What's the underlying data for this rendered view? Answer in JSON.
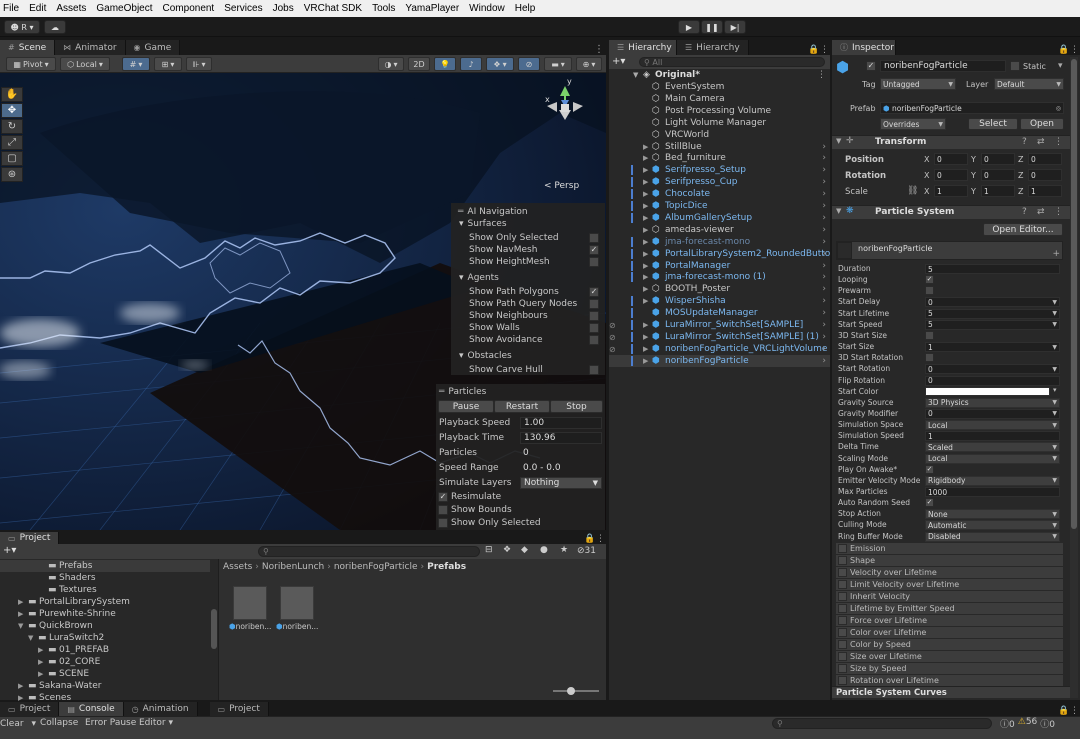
{
  "menubar": [
    "File",
    "Edit",
    "Assets",
    "GameObject",
    "Component",
    "Services",
    "Jobs",
    "VRChat SDK",
    "Tools",
    "YamaPlayer",
    "Window",
    "Help"
  ],
  "toolbar": {
    "account_label": "R"
  },
  "scene": {
    "tabs": [
      "Scene",
      "Animator",
      "Game"
    ],
    "pivot": "Pivot",
    "local": "Local",
    "mode_2d": "2D",
    "persp": "Persp",
    "ai_nav": {
      "title": "AI Navigation",
      "surfaces": "Surfaces",
      "surf_items": [
        {
          "label": "Show Only Selected",
          "checked": false
        },
        {
          "label": "Show NavMesh",
          "checked": true
        },
        {
          "label": "Show HeightMesh",
          "checked": false
        }
      ],
      "agents": "Agents",
      "agent_items": [
        {
          "label": "Show Path Polygons",
          "checked": true
        },
        {
          "label": "Show Path Query Nodes",
          "checked": false
        },
        {
          "label": "Show Neighbours",
          "checked": false
        },
        {
          "label": "Show Walls",
          "checked": false
        },
        {
          "label": "Show Avoidance",
          "checked": false
        }
      ],
      "obstacles": "Obstacles",
      "obstacle_items": [
        {
          "label": "Show Carve Hull",
          "checked": false
        }
      ]
    },
    "particles": {
      "title": "Particles",
      "pause": "Pause",
      "restart": "Restart",
      "stop": "Stop",
      "rows": [
        {
          "label": "Playback Speed",
          "value": "1.00"
        },
        {
          "label": "Playback Time",
          "value": "130.96"
        },
        {
          "label": "Particles",
          "value": "0"
        },
        {
          "label": "Speed Range",
          "value": "0.0 - 0.0"
        },
        {
          "label": "Simulate Layers",
          "value": "Nothing"
        }
      ],
      "checks": [
        {
          "label": "Resimulate",
          "checked": true
        },
        {
          "label": "Show Bounds",
          "checked": false
        },
        {
          "label": "Show Only Selected",
          "checked": false
        }
      ]
    }
  },
  "hierarchy": {
    "tabs": [
      "Hierarchy",
      "Hierarchy"
    ],
    "search_placeholder": "All",
    "root": "Original*",
    "items": [
      {
        "name": "EventSystem",
        "type": "go",
        "arrow": false
      },
      {
        "name": "Main Camera",
        "type": "go",
        "arrow": false
      },
      {
        "name": "Post Processing Volume",
        "type": "go",
        "arrow": false
      },
      {
        "name": "Light Volume Manager",
        "type": "go",
        "arrow": false
      },
      {
        "name": "VRCWorld",
        "type": "go",
        "arrow": false
      },
      {
        "name": "StillBlue",
        "type": "go",
        "arrow": true
      },
      {
        "name": "Bed_furniture",
        "type": "go",
        "arrow": true
      },
      {
        "name": "Serifpresso_Setup",
        "type": "prefab",
        "arrow": true
      },
      {
        "name": "Serifpresso_Cup",
        "type": "prefab",
        "arrow": true
      },
      {
        "name": "Chocolate",
        "type": "prefab",
        "arrow": true
      },
      {
        "name": "TopicDice",
        "type": "prefab",
        "arrow": true
      },
      {
        "name": "AlbumGallerySetup",
        "type": "prefab",
        "arrow": true
      },
      {
        "name": "amedas-viewer",
        "type": "go",
        "arrow": true
      },
      {
        "name": "jma-forecast-mono",
        "type": "dis",
        "arrow": true
      },
      {
        "name": "PortalLibrarySystem2_RoundedButto",
        "type": "prefab",
        "arrow": true
      },
      {
        "name": "PortalManager",
        "type": "prefab",
        "arrow": true
      },
      {
        "name": "jma-forecast-mono (1)",
        "type": "prefab",
        "arrow": true
      },
      {
        "name": "BOOTH_Poster",
        "type": "go",
        "arrow": true
      },
      {
        "name": "WisperShisha",
        "type": "prefab",
        "arrow": true
      },
      {
        "name": "MOSUpdateManager",
        "type": "prefab",
        "arrow": false
      },
      {
        "name": "LuraMirror_SwitchSet[SAMPLE]",
        "type": "prefab",
        "arrow": true
      },
      {
        "name": "LuraMirror_SwitchSet[SAMPLE] (1)",
        "type": "prefab",
        "arrow": true
      },
      {
        "name": "noribenFogParticle_VRCLightVolume",
        "type": "prefab",
        "arrow": true
      },
      {
        "name": "noribenFogParticle",
        "type": "prefab",
        "arrow": true,
        "selected": true
      }
    ]
  },
  "inspector": {
    "tab": "Inspector",
    "object_name": "noribenFogParticle",
    "static_label": "Static",
    "tag_label": "Tag",
    "tag_value": "Untagged",
    "layer_label": "Layer",
    "layer_value": "Default",
    "prefab_label": "Prefab",
    "prefab_value": "noribenFogParticle",
    "overrides": "Overrides",
    "select": "Select",
    "open": "Open",
    "transform": {
      "title": "Transform",
      "rows": [
        {
          "label": "Position",
          "x": "0",
          "y": "0",
          "z": "0"
        },
        {
          "label": "Rotation",
          "x": "0",
          "y": "0",
          "z": "0"
        },
        {
          "label": "Scale",
          "x": "1",
          "y": "1",
          "z": "1"
        }
      ]
    },
    "particle_system": {
      "title": "Particle System",
      "open_editor": "Open Editor...",
      "header": "noribenFogParticle",
      "props": [
        {
          "label": "Duration",
          "value": "5",
          "kind": "field"
        },
        {
          "label": "Looping",
          "value": "✓",
          "kind": "check"
        },
        {
          "label": "Prewarm",
          "value": "",
          "kind": "check"
        },
        {
          "label": "Start Delay",
          "value": "0",
          "kind": "drop"
        },
        {
          "label": "Start Lifetime",
          "value": "5",
          "kind": "drop"
        },
        {
          "label": "Start Speed",
          "value": "5",
          "kind": "drop"
        },
        {
          "label": "3D Start Size",
          "value": "",
          "kind": "check"
        },
        {
          "label": "Start Size",
          "value": "1",
          "kind": "drop"
        },
        {
          "label": "3D Start Rotation",
          "value": "",
          "kind": "check"
        },
        {
          "label": "Start Rotation",
          "value": "0",
          "kind": "drop"
        },
        {
          "label": "Flip Rotation",
          "value": "0",
          "kind": "field"
        },
        {
          "label": "Start Color",
          "value": "",
          "kind": "color"
        },
        {
          "label": "Gravity Source",
          "value": "3D Physics",
          "kind": "drop"
        },
        {
          "label": "Gravity Modifier",
          "value": "0",
          "kind": "drop"
        },
        {
          "label": "Simulation Space",
          "value": "Local",
          "kind": "drop"
        },
        {
          "label": "Simulation Speed",
          "value": "1",
          "kind": "field"
        },
        {
          "label": "Delta Time",
          "value": "Scaled",
          "kind": "drop"
        },
        {
          "label": "Scaling Mode",
          "value": "Local",
          "kind": "drop"
        },
        {
          "label": "Play On Awake*",
          "value": "✓",
          "kind": "check"
        },
        {
          "label": "Emitter Velocity Mode",
          "value": "Rigidbody",
          "kind": "drop"
        },
        {
          "label": "Max Particles",
          "value": "1000",
          "kind": "field"
        },
        {
          "label": "Auto Random Seed",
          "value": "✓",
          "kind": "check"
        },
        {
          "label": "Stop Action",
          "value": "None",
          "kind": "drop"
        },
        {
          "label": "Culling Mode",
          "value": "Automatic",
          "kind": "drop"
        },
        {
          "label": "Ring Buffer Mode",
          "value": "Disabled",
          "kind": "drop"
        }
      ],
      "modules": [
        "Emission",
        "Shape",
        "Velocity over Lifetime",
        "Limit Velocity over Lifetime",
        "Inherit Velocity",
        "Lifetime by Emitter Speed",
        "Force over Lifetime",
        "Color over Lifetime",
        "Color by Speed",
        "Size over Lifetime",
        "Size by Speed",
        "Rotation over Lifetime"
      ],
      "curves": "Particle System Curves"
    }
  },
  "project": {
    "tab": "Project",
    "tree": [
      {
        "name": "Prefabs",
        "indent": 3,
        "arrow": false,
        "sel": true
      },
      {
        "name": "Shaders",
        "indent": 3,
        "arrow": false
      },
      {
        "name": "Textures",
        "indent": 3,
        "arrow": false
      },
      {
        "name": "PortalLibrarySystem",
        "indent": 1,
        "arrow": true
      },
      {
        "name": "Purewhite-Shrine",
        "indent": 1,
        "arrow": true
      },
      {
        "name": "QuickBrown",
        "indent": 1,
        "arrow": true,
        "open": true
      },
      {
        "name": "LuraSwitch2",
        "indent": 2,
        "arrow": true,
        "open": true
      },
      {
        "name": "01_PREFAB",
        "indent": 3,
        "arrow": true
      },
      {
        "name": "02_CORE",
        "indent": 3,
        "arrow": true
      },
      {
        "name": "SCENE",
        "indent": 3,
        "arrow": true
      },
      {
        "name": "Sakana-Water",
        "indent": 1,
        "arrow": true
      },
      {
        "name": "Scenes",
        "indent": 1,
        "arrow": true
      }
    ],
    "breadcrumb": [
      "Assets",
      "NoribenLunch",
      "noribenFogParticle",
      "Prefabs"
    ],
    "assets": [
      "noriben...",
      "noriben..."
    ],
    "hidden_count": "31"
  },
  "bottom": {
    "tabs": [
      "Project",
      "Console",
      "Animation",
      "Project"
    ],
    "clear": "Clear",
    "collapse": "Collapse",
    "error_pause": "Error Pause",
    "editor": "Editor",
    "log_count": "0",
    "warn_count": "56",
    "error_count": "0"
  },
  "colors": {
    "accent": "#4c7ed0",
    "prefab_text": "#7cb8f0",
    "navmesh_outline": "#9ab2e6"
  }
}
